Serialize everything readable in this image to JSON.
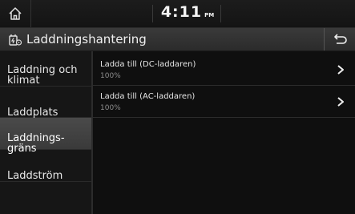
{
  "statusbar": {
    "time": "4:11",
    "ampm": "PM"
  },
  "header": {
    "title": "Laddningshantering",
    "icon": "charging-settings-icon",
    "back_icon": "back-arrow-icon"
  },
  "sidebar": {
    "items": [
      {
        "label": "Laddning och\nklimat",
        "selected": false
      },
      {
        "label": "Laddplats",
        "selected": false
      },
      {
        "label": "Laddnings-\ngräns",
        "selected": true
      },
      {
        "label": "Laddström",
        "selected": false
      }
    ]
  },
  "main": {
    "rows": [
      {
        "label": "Ladda till (DC-laddaren)",
        "value": "100%"
      },
      {
        "label": "Ladda till (AC-laddaren)",
        "value": "100%"
      }
    ]
  },
  "colors": {
    "selected_bg": "#404040",
    "text": "#e6e6e6",
    "subtext": "#8c8c8c"
  }
}
